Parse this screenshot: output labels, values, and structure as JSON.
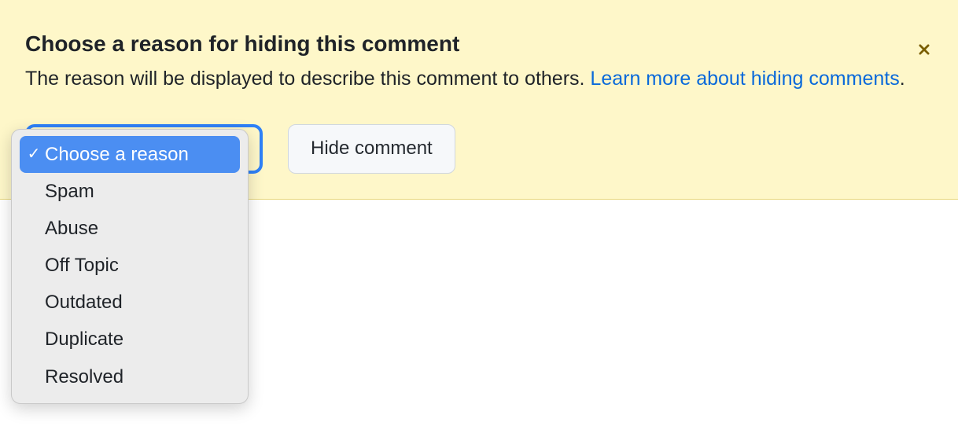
{
  "banner": {
    "title": "Choose a reason for hiding this comment",
    "subtitle_prefix": "The reason will be displayed to describe this comment to others. ",
    "learn_more_text": "Learn more about hiding comments",
    "subtitle_suffix": "."
  },
  "dropdown": {
    "selected": "Choose a reason",
    "options": [
      "Choose a reason",
      "Spam",
      "Abuse",
      "Off Topic",
      "Outdated",
      "Duplicate",
      "Resolved"
    ]
  },
  "buttons": {
    "hide_comment": "Hide comment"
  },
  "icons": {
    "close": "close-icon",
    "check": "✓"
  }
}
